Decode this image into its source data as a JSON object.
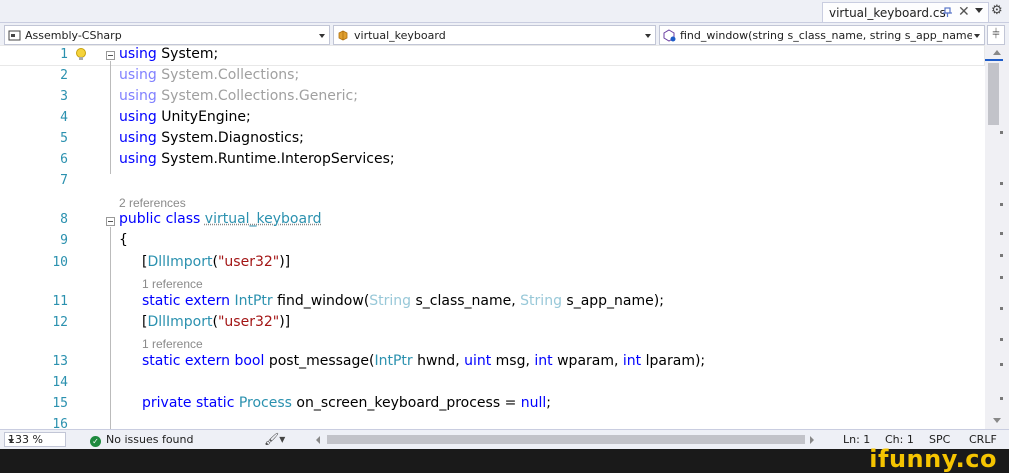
{
  "tab": {
    "title": "virtual_keyboard.cs",
    "pin_icon": "pin-icon",
    "close_glyph": "✕",
    "settings_glyph": "⚙"
  },
  "navbar": {
    "project": "Assembly-CSharp",
    "type": "virtual_keyboard",
    "member": "find_window(string s_class_name, string s_app_name)",
    "split_glyph": "⫩"
  },
  "editor": {
    "line_numbers": [
      "1",
      "2",
      "3",
      "4",
      "5",
      "6",
      "7",
      "8",
      "9",
      "10",
      "11",
      "12",
      "13",
      "14",
      "15",
      "16"
    ],
    "lens": {
      "class_refs": "2 references",
      "method1_refs": "1 reference",
      "method2_refs": "1 reference"
    },
    "code": {
      "l1": {
        "kw": "using",
        "rest": " System;"
      },
      "l2": {
        "kw": "using",
        "rest": " System.Collections;"
      },
      "l3": {
        "kw": "using",
        "rest": " System.Collections.Generic;"
      },
      "l4": {
        "kw": "using",
        "rest": " UnityEngine;"
      },
      "l5": {
        "kw": "using",
        "rest": " System.Diagnostics;"
      },
      "l6": {
        "kw": "using",
        "rest": " System.Runtime.InteropServices;"
      },
      "l8": {
        "kw": "public class",
        "name": "virtual_keyboard"
      },
      "l9": {
        "text": "{"
      },
      "l10": {
        "open": "[",
        "attr": "DllImport",
        "paren": "(",
        "str": "\"user32\"",
        "close": ")]"
      },
      "l11": {
        "kw": "static extern",
        "ty": "IntPtr",
        "name": " find_window(",
        "p1ty": "String",
        "p1": " s_class_name, ",
        "p2ty": "String",
        "p2": " s_app_name);"
      },
      "l12": {
        "open": "[",
        "attr": "DllImport",
        "paren": "(",
        "str": "\"user32\"",
        "close": ")]"
      },
      "l13": {
        "kw": "static extern bool",
        "name": " post_message(",
        "ty": "IntPtr",
        "a": " hwnd, ",
        "k2": "uint",
        "b": " msg, ",
        "k3": "int",
        "c": " wparam, ",
        "k4": "int",
        "d": " lparam);"
      },
      "l15": {
        "kw": "private static",
        "ty": "Process",
        "rest": " on_screen_keyboard_process = ",
        "kw2": "null",
        "end": ";"
      }
    }
  },
  "statusbar": {
    "zoom": "133 %",
    "issues": "No issues found",
    "ln": "Ln: 1",
    "ch": "Ch: 1",
    "spc": "SPC",
    "crlf": "CRLF"
  },
  "watermark": "ifunny.co"
}
